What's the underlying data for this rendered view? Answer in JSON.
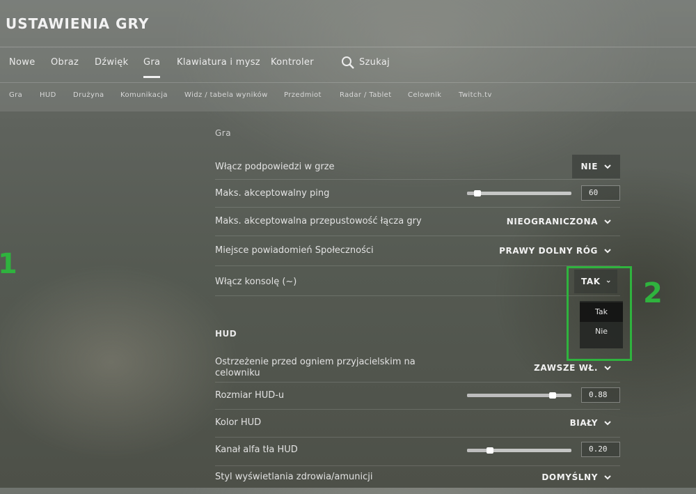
{
  "header": {
    "title": "USTAWIENIA GRY"
  },
  "tabs": [
    {
      "label": "Nowe",
      "active": false
    },
    {
      "label": "Obraz",
      "active": false
    },
    {
      "label": "Dźwięk",
      "active": false
    },
    {
      "label": "Gra",
      "active": true
    },
    {
      "label": "Klawiatura i mysz",
      "active": false
    },
    {
      "label": "Kontroler",
      "active": false
    }
  ],
  "search": {
    "label": "Szukaj",
    "icon": "search-icon"
  },
  "subtabs": [
    "Gra",
    "HUD",
    "Drużyna",
    "Komunikacja",
    "Widz / tabela wyników",
    "Przedmiot",
    "Radar / Tablet",
    "Celownik",
    "Twitch.tv"
  ],
  "sections": {
    "game": {
      "title": "Gra"
    },
    "hud": {
      "title": "HUD"
    }
  },
  "game_rows": [
    {
      "label": "Włącz podpowiedzi w grze",
      "value": "NIE"
    },
    {
      "label": "Maks. akceptowalny ping",
      "value": "60",
      "slider": 0.1
    },
    {
      "label": "Maks. akceptowalna przepustowość łącza gry",
      "value": "NIEOGRANICZONA"
    },
    {
      "label": "Miejsce powiadomień Społeczności",
      "value": "PRAWY DOLNY RÓG"
    },
    {
      "label": "Włącz konsolę (~)",
      "value": "TAK"
    }
  ],
  "console_menu": {
    "options": [
      "Tak",
      "Nie"
    ],
    "highlighted": "Tak"
  },
  "hud_rows": [
    {
      "label": "Ostrzeżenie przed ogniem przyjacielskim na celowniku",
      "value": "ZAWSZE WŁ."
    },
    {
      "label": "Rozmiar HUD-u",
      "value": "0.88",
      "slider": 0.82
    },
    {
      "label": "Kolor HUD",
      "value": "BIAŁY"
    },
    {
      "label": "Kanał alfa tła HUD",
      "value": "0.20",
      "slider": 0.22
    },
    {
      "label": "Styl wyświetlania zdrowia/amunicji",
      "value": "DOMYŚLNY"
    }
  ],
  "annotations": {
    "one": "1",
    "two": "2",
    "color": "#2fb33e"
  }
}
